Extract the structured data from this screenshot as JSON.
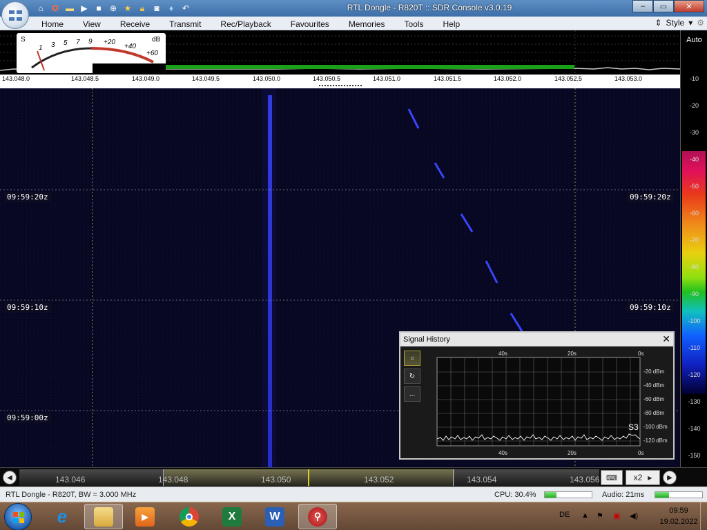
{
  "window": {
    "title": "RTL Dongle - R820T :: SDR Console v3.0.19",
    "controls": [
      "–",
      "▭",
      "✕"
    ]
  },
  "qat_icons": [
    "home-icon",
    "lifebuoy-icon",
    "folder-icon",
    "play-icon",
    "stop-icon",
    "add-icon",
    "star-icon",
    "lock-icon",
    "camera-icon",
    "drop-icon",
    "undo-icon"
  ],
  "menu": {
    "items": [
      "Home",
      "View",
      "Receive",
      "Transmit",
      "Rec/Playback",
      "Favourites",
      "Memories",
      "Tools",
      "Help"
    ],
    "style_label": "Style"
  },
  "smeter": {
    "s_label": "S",
    "db_label": "dB",
    "scale": [
      "1",
      "3",
      "5",
      "7",
      "9",
      "+20",
      "+40",
      "+60"
    ]
  },
  "freq_axis": [
    "143.048.0",
    "143.048.5",
    "143.049.0",
    "143.049.5",
    "143.050.0",
    "143.050.5",
    "143.051.0",
    "143.051.5",
    "143.052.0",
    "143.052.5",
    "143.053.0"
  ],
  "right_scale": {
    "auto_label": "Auto",
    "db_values": [
      "-10",
      "-20",
      "-30",
      "-40",
      "-50",
      "-60",
      "-70",
      "-80",
      "-90",
      "-100",
      "-110",
      "-120",
      "-130",
      "-140",
      "-150"
    ]
  },
  "waterfall": {
    "time_labels": [
      "09:59:20z",
      "09:59:10z",
      "09:59:00z"
    ]
  },
  "tune_bar": {
    "labels": [
      "143.046",
      "143.048",
      "143.050",
      "143.052",
      "143.054",
      "143.056"
    ],
    "zoom_label": "x2"
  },
  "status": {
    "left": "RTL Dongle - R820T, BW = 3.000 MHz",
    "cpu": "CPU: 30.4%",
    "cpu_level": 0.25,
    "audio": "Audio: 21ms",
    "audio_level": 0.3
  },
  "signal_history": {
    "title": "Signal History",
    "tools": [
      "○",
      "↻",
      "..."
    ],
    "top_times": [
      "40s",
      "20s",
      "0s"
    ],
    "bottom_times": [
      "40s",
      "20s",
      "0s"
    ],
    "db_labels": [
      "-20 dBm",
      "-40 dBm",
      "-60 dBm",
      "-80 dBm",
      "-100 dBm",
      "-120 dBm"
    ],
    "s_reading": "S3"
  },
  "taskbar": {
    "apps": [
      "internet-explorer",
      "file-explorer",
      "media-player",
      "chrome",
      "excel",
      "word",
      "sdr-console"
    ],
    "language": "DE",
    "time": "09:59",
    "date": "19.02.2022"
  }
}
